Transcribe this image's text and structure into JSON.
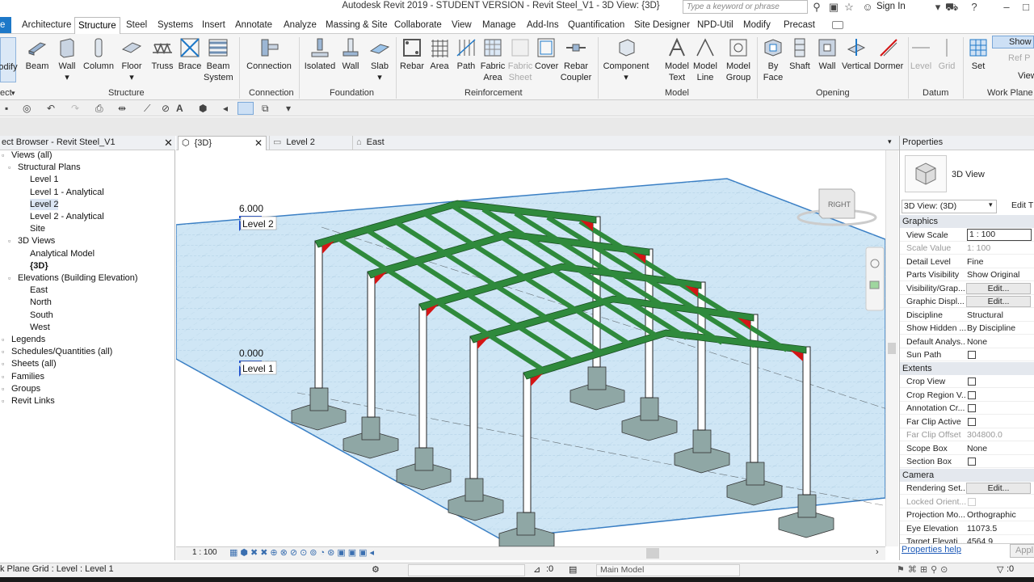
{
  "titlebar": {
    "title": "Autodesk Revit 2019 - STUDENT VERSION - Revit Steel_V1 - 3D View: {3D}",
    "search_placeholder": "Type a keyword or phrase",
    "sign_in": "Sign In"
  },
  "tabs": [
    "Architecture",
    "Structure",
    "Steel",
    "Systems",
    "Insert",
    "Annotate",
    "Analyze",
    "Massing & Site",
    "Collaborate",
    "View",
    "Manage",
    "Add-Ins",
    "Quantification",
    "Site Designer",
    "NPD-Util",
    "Modify",
    "Precast"
  ],
  "active_tab": "Structure",
  "file_tab": "e",
  "ribbon": {
    "buttons": [
      {
        "label": "odify",
        "icon": "modify-icon"
      },
      {
        "label": "Beam",
        "icon": "beam-icon"
      },
      {
        "label": "Wall",
        "icon": "wall-icon"
      },
      {
        "label": "Column",
        "icon": "column-icon"
      },
      {
        "label": "Floor",
        "icon": "floor-icon"
      },
      {
        "label": "Truss",
        "icon": "truss-icon"
      },
      {
        "label": "Brace",
        "icon": "brace-icon"
      },
      {
        "label": "Beam System",
        "icon": "beam-system-icon"
      },
      {
        "label": "Connection",
        "icon": "connection-icon"
      },
      {
        "label": "Isolated",
        "icon": "isolated-foundation-icon"
      },
      {
        "label": "Wall",
        "icon": "wall-foundation-icon"
      },
      {
        "label": "Slab",
        "icon": "slab-icon"
      },
      {
        "label": "Rebar",
        "icon": "rebar-icon"
      },
      {
        "label": "Area",
        "icon": "area-icon"
      },
      {
        "label": "Path",
        "icon": "path-icon"
      },
      {
        "label": "Fabric Area",
        "icon": "fabric-area-icon"
      },
      {
        "label": "Fabric Sheet",
        "icon": "fabric-sheet-icon"
      },
      {
        "label": "Cover",
        "icon": "cover-icon"
      },
      {
        "label": "Rebar Coupler",
        "icon": "rebar-coupler-icon"
      },
      {
        "label": "Component",
        "icon": "component-icon"
      },
      {
        "label": "Model Text",
        "icon": "model-text-icon"
      },
      {
        "label": "Model Line",
        "icon": "model-line-icon"
      },
      {
        "label": "Model Group",
        "icon": "model-group-icon"
      },
      {
        "label": "By Face",
        "icon": "by-face-icon"
      },
      {
        "label": "Shaft",
        "icon": "shaft-icon"
      },
      {
        "label": "Wall",
        "icon": "wall-opening-icon"
      },
      {
        "label": "Vertical",
        "icon": "vertical-opening-icon"
      },
      {
        "label": "Dormer",
        "icon": "dormer-icon"
      },
      {
        "label": "Level",
        "icon": "level-icon"
      },
      {
        "label": "Grid",
        "icon": "grid-icon"
      },
      {
        "label": "Set",
        "icon": "set-icon"
      }
    ],
    "workplane_items": [
      "Show",
      "Ref P",
      "Viewer"
    ],
    "panels": [
      "ect",
      "Structure",
      "Connection",
      "Foundation",
      "Reinforcement",
      "Model",
      "Opening",
      "Datum",
      "Work Plane"
    ]
  },
  "project_browser": {
    "title": "ect Browser - Revit Steel_V1",
    "items": [
      {
        "label": "Views (all)",
        "level": 0
      },
      {
        "label": "Structural Plans",
        "level": 1
      },
      {
        "label": "Level 1",
        "level": 2
      },
      {
        "label": "Level 1 - Analytical",
        "level": 2
      },
      {
        "label": "Level 2",
        "level": 2,
        "selected": true
      },
      {
        "label": "Level 2 - Analytical",
        "level": 2
      },
      {
        "label": "Site",
        "level": 2
      },
      {
        "label": "3D Views",
        "level": 1
      },
      {
        "label": "Analytical Model",
        "level": 2
      },
      {
        "label": "{3D}",
        "level": 2,
        "bold": true
      },
      {
        "label": "Elevations (Building Elevation)",
        "level": 1
      },
      {
        "label": "East",
        "level": 2
      },
      {
        "label": "North",
        "level": 2
      },
      {
        "label": "South",
        "level": 2
      },
      {
        "label": "West",
        "level": 2
      },
      {
        "label": "Legends",
        "level": 0
      },
      {
        "label": "Schedules/Quantities (all)",
        "level": 0
      },
      {
        "label": "Sheets (all)",
        "level": 0
      },
      {
        "label": "Families",
        "level": 0
      },
      {
        "label": "Groups",
        "level": 0
      },
      {
        "label": "Revit Links",
        "level": 0
      }
    ]
  },
  "view_tabs": [
    {
      "label": "{3D}",
      "active": true
    },
    {
      "label": "Level 2",
      "active": false
    },
    {
      "label": "East",
      "active": false
    }
  ],
  "canvas": {
    "level2_elev": "6.000",
    "level2_name": "Level 2",
    "level1_elev": "0.000",
    "level1_name": "Level 1",
    "viewcube_face": "RIGHT"
  },
  "view_control": {
    "scale": "1 : 100"
  },
  "properties": {
    "title": "Properties",
    "type_name": "3D View",
    "selector": "3D View: (3D)",
    "edit_type": "Edit T",
    "groups": [
      {
        "name": "Graphics",
        "rows": [
          {
            "key": "View Scale",
            "value": "1 : 100",
            "kind": "input"
          },
          {
            "key": "Scale Value",
            "value": "1: 100",
            "kind": "grey"
          },
          {
            "key": "Detail Level",
            "value": "Fine"
          },
          {
            "key": "Parts Visibility",
            "value": "Show Original"
          },
          {
            "key": "Visibility/Grap...",
            "value": "Edit...",
            "kind": "button"
          },
          {
            "key": "Graphic Displ...",
            "value": "Edit...",
            "kind": "button"
          },
          {
            "key": "Discipline",
            "value": "Structural"
          },
          {
            "key": "Show Hidden ...",
            "value": "By Discipline"
          },
          {
            "key": "Default Analys...",
            "value": "None"
          },
          {
            "key": "Sun Path",
            "value": "",
            "kind": "check"
          }
        ]
      },
      {
        "name": "Extents",
        "rows": [
          {
            "key": "Crop View",
            "value": "",
            "kind": "check"
          },
          {
            "key": "Crop Region V...",
            "value": "",
            "kind": "check"
          },
          {
            "key": "Annotation Cr...",
            "value": "",
            "kind": "check"
          },
          {
            "key": "Far Clip Active",
            "value": "",
            "kind": "check"
          },
          {
            "key": "Far Clip Offset",
            "value": "304800.0",
            "kind": "grey"
          },
          {
            "key": "Scope Box",
            "value": "None"
          },
          {
            "key": "Section Box",
            "value": "",
            "kind": "check"
          }
        ]
      },
      {
        "name": "Camera",
        "rows": [
          {
            "key": "Rendering Set...",
            "value": "Edit...",
            "kind": "button"
          },
          {
            "key": "Locked Orient...",
            "value": "",
            "kind": "greycheck"
          },
          {
            "key": "Projection Mo...",
            "value": "Orthographic"
          },
          {
            "key": "Eye Elevation",
            "value": "11073.5"
          },
          {
            "key": "Target Elevati...",
            "value": "4564.9"
          }
        ]
      }
    ],
    "help_link": "Properties help",
    "apply": "Appl"
  },
  "status": {
    "message": "k Plane Grid : Level : Level 1",
    "coord": ":0",
    "model": "Main Model",
    "filter_count": ":0"
  },
  "colors": {
    "accent": "#1d78c8",
    "beam": "#2f8a3c",
    "plate": "#d41515",
    "slab": "#cfe6f5"
  }
}
